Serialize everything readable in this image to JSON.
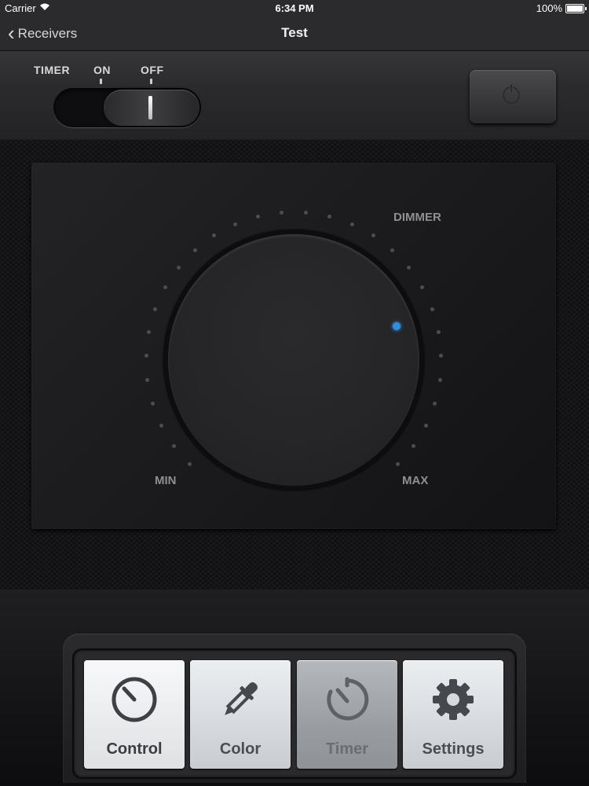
{
  "status_bar": {
    "carrier": "Carrier",
    "time": "6:34 PM",
    "battery": "100%"
  },
  "nav": {
    "back_label": "Receivers",
    "title": "Test"
  },
  "timer_switch": {
    "label": "TIMER",
    "on_label": "ON",
    "off_label": "OFF",
    "state": "OFF"
  },
  "power_button": {
    "icon": "power-icon"
  },
  "dimmer": {
    "label": "DIMMER",
    "min_label": "MIN",
    "max_label": "MAX",
    "indicator_color": "#2e8fe0"
  },
  "tabs": [
    {
      "label": "Control",
      "icon": "gauge-icon",
      "state": "selected"
    },
    {
      "label": "Color",
      "icon": "eyedropper-icon",
      "state": "normal"
    },
    {
      "label": "Timer",
      "icon": "timer-icon",
      "state": "disabled"
    },
    {
      "label": "Settings",
      "icon": "gear-icon",
      "state": "normal"
    }
  ]
}
